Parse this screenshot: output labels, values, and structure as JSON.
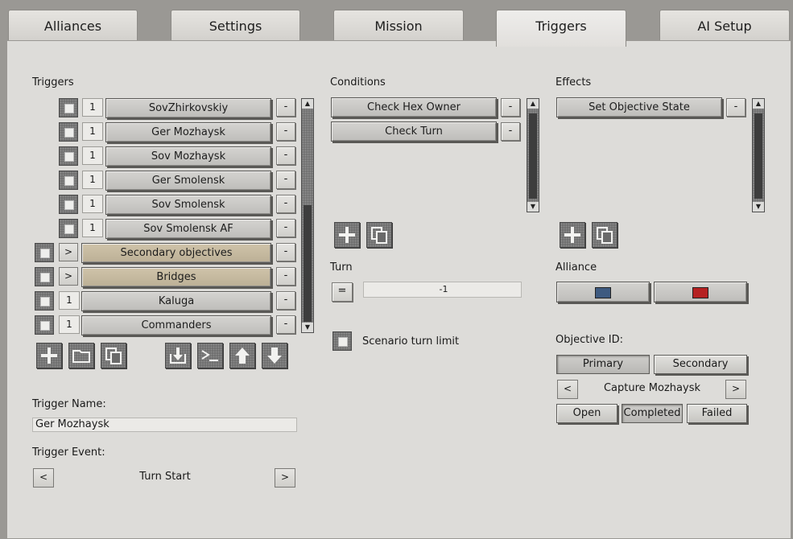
{
  "tabs": [
    "Alliances",
    "Settings",
    "Mission",
    "Triggers",
    "AI Setup"
  ],
  "triggers": {
    "label": "Triggers",
    "rows": [
      {
        "num": "1",
        "name": "SovZhirkovskiy"
      },
      {
        "num": "1",
        "name": "Ger Mozhaysk"
      },
      {
        "num": "1",
        "name": "Sov Mozhaysk"
      },
      {
        "num": "1",
        "name": "Ger Smolensk"
      },
      {
        "num": "1",
        "name": "Sov Smolensk"
      },
      {
        "num": "1",
        "name": "Sov Smolensk AF"
      }
    ],
    "groups": [
      {
        "expander": ">",
        "name": "Secondary objectives"
      },
      {
        "expander": ">",
        "name": "Bridges"
      }
    ],
    "extra_rows": [
      {
        "num": "1",
        "name": "Kaluga"
      },
      {
        "num": "1",
        "name": "Commanders"
      }
    ],
    "minus_label": "-",
    "toolbar_icons": [
      "add-icon",
      "folder-icon",
      "copy-icon",
      "import-icon",
      "console-icon",
      "arrow-up-icon",
      "arrow-down-icon"
    ]
  },
  "trigger_name": {
    "label": "Trigger Name:",
    "value": "Ger Mozhaysk"
  },
  "trigger_event": {
    "label": "Trigger Event:",
    "value": "Turn Start",
    "prev": "<",
    "next": ">"
  },
  "conditions": {
    "label": "Conditions",
    "items": [
      "Check Hex Owner",
      "Check Turn"
    ],
    "minus_label": "-"
  },
  "turn": {
    "label": "Turn",
    "operator": "=",
    "value": "-1"
  },
  "scenario_turn_limit": {
    "label": "Scenario turn limit"
  },
  "effects": {
    "label": "Effects",
    "items": [
      "Set Objective State"
    ],
    "minus_label": "-"
  },
  "alliance": {
    "label": "Alliance",
    "colors": [
      "#3e5a80",
      "#b52121"
    ]
  },
  "objective": {
    "label": "Objective ID:",
    "types": [
      "Primary",
      "Secondary"
    ],
    "selected_type": "Primary",
    "prev": "<",
    "next": ">",
    "value": "Capture Mozhaysk",
    "states": [
      "Open",
      "Completed",
      "Failed"
    ],
    "selected_state": "Completed"
  }
}
